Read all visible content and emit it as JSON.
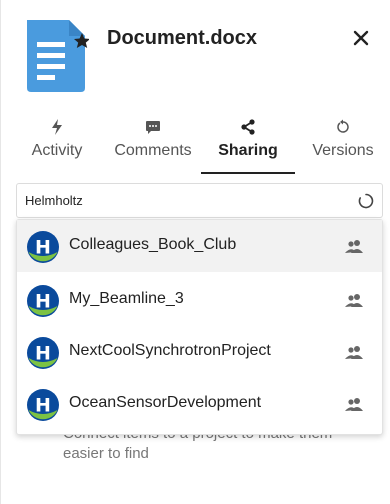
{
  "document": {
    "title": "Document.docx",
    "icon": "document-starred-icon",
    "accent_color": "#4a9bde"
  },
  "tabs": [
    {
      "label": "Activity",
      "icon": "lightning-icon",
      "active": false
    },
    {
      "label": "Comments",
      "icon": "comment-icon",
      "active": false
    },
    {
      "label": "Sharing",
      "icon": "share-icon",
      "active": true
    },
    {
      "label": "Versions",
      "icon": "history-icon",
      "active": false
    }
  ],
  "search": {
    "value": "Helmholtz",
    "placeholder": ""
  },
  "results": [
    {
      "label": "Colleagues_Book_Club",
      "avatar_letter": "H",
      "icon": "group-icon"
    },
    {
      "label": "My_Beamline_3",
      "avatar_letter": "H",
      "icon": "group-icon"
    },
    {
      "label": "NextCoolSynchrotronProject",
      "avatar_letter": "H",
      "icon": "group-icon"
    },
    {
      "label": "OceanSensorDevelopment",
      "avatar_letter": "H",
      "icon": "group-icon"
    }
  ],
  "hint": {
    "text": "Connect items to a project to make them easier to find"
  },
  "colors": {
    "avatar_blue": "#0a4a9c",
    "avatar_green": "#7cc243",
    "hover_bg": "#f2f2f2"
  }
}
